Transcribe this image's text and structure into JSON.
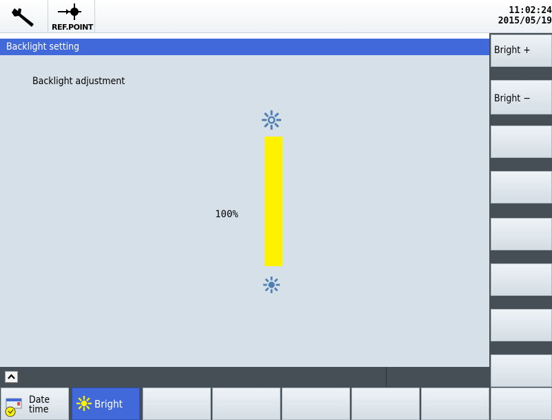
{
  "header": {
    "wrench_icon": "wrench-icon",
    "ref_icon": "ref-point-icon",
    "ref_label": "REF.POINT",
    "time": "11:02:24",
    "date": "2015/05/19"
  },
  "titlebar": {
    "title": "Backlight setting"
  },
  "main": {
    "subtitle": "Backlight adjustment",
    "brightness_percent": "100%",
    "brightness_level": 1.0,
    "bar_color": "#fff200",
    "sun_color": "#4d7fb3"
  },
  "vertical_softkeys": [
    "Bright +",
    "",
    "Bright −",
    "",
    "",
    "",
    "",
    "",
    ""
  ],
  "bottom_softkeys": {
    "datetime_line1": "Date",
    "datetime_line2": "time",
    "bright": "Bright"
  },
  "colors": {
    "accent": "#4169d9",
    "panel": "#d6e0e8",
    "dark": "#454f55"
  }
}
